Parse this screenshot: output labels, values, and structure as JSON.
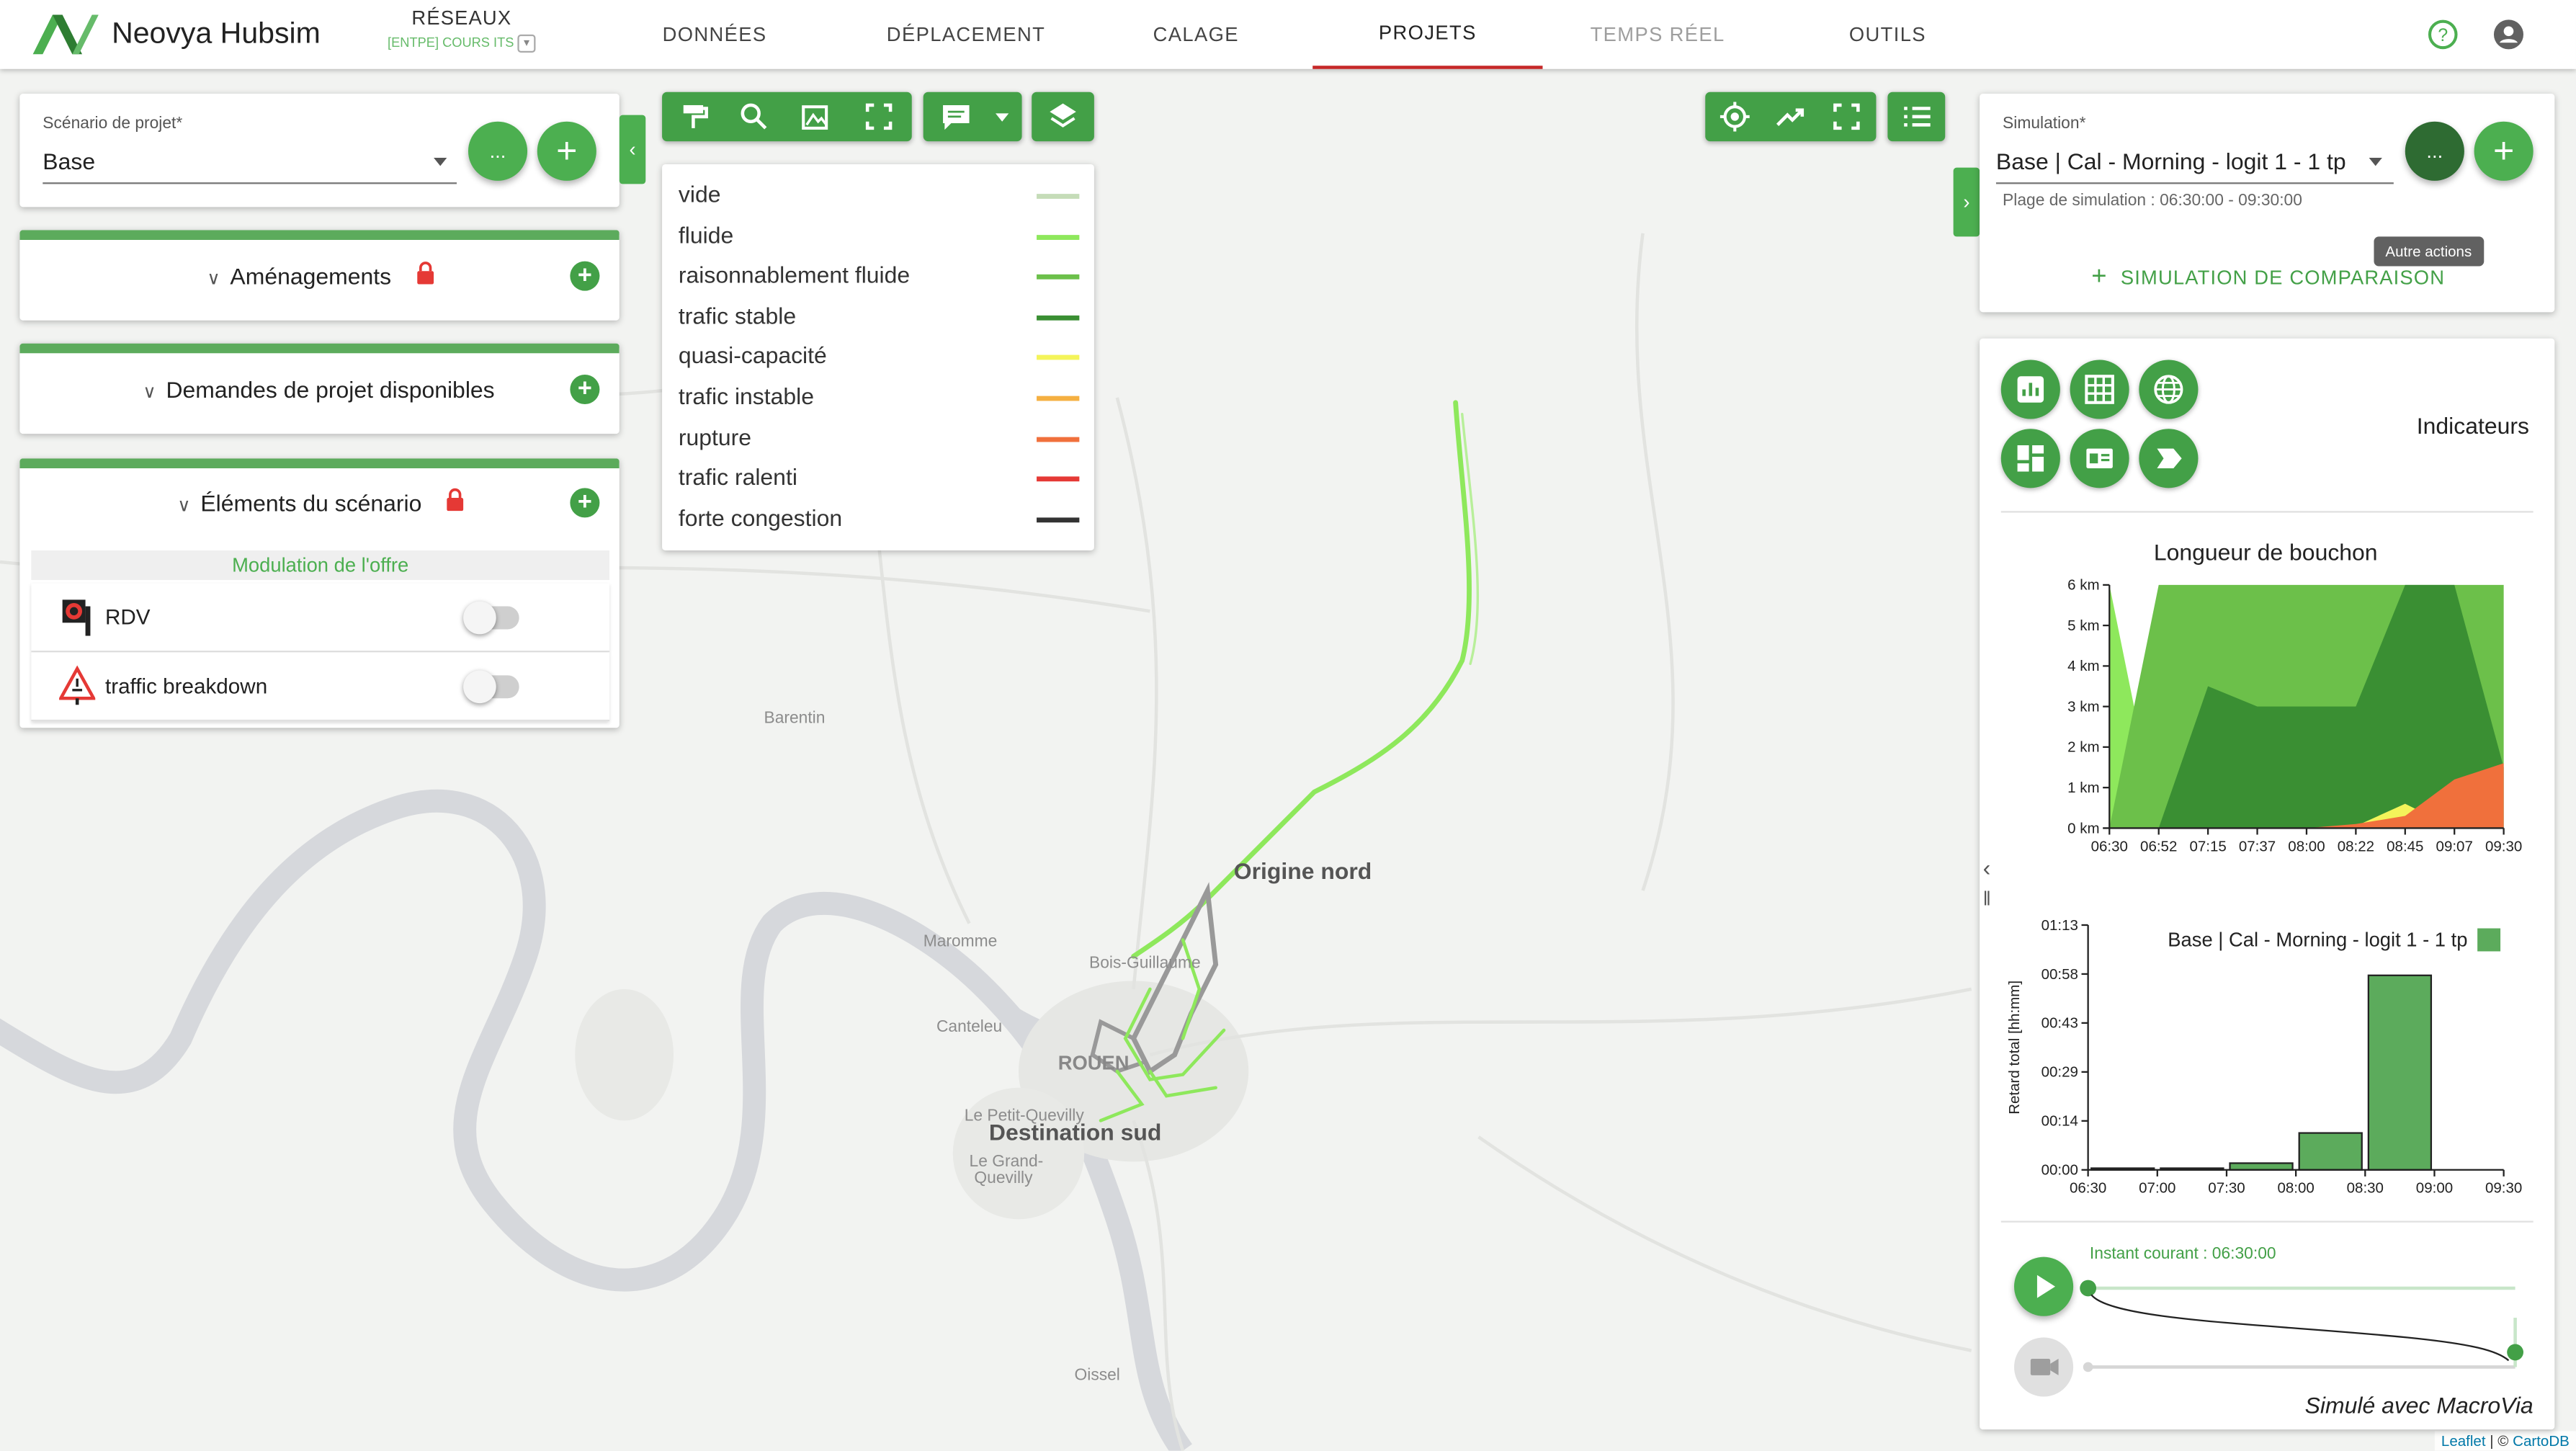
{
  "app": {
    "brand": "Neovya Hubsim"
  },
  "network": {
    "title": "RÉSEAUX",
    "subtitle": "[ENTPE] COURS ITS"
  },
  "nav": [
    "DONNÉES",
    "DÉPLACEMENT",
    "CALAGE",
    "PROJETS",
    "TEMPS RÉEL",
    "OUTILS"
  ],
  "scenario": {
    "label": "Scénario de projet",
    "value": "Base",
    "more": "..."
  },
  "sections": {
    "amenagements": "Aménagements",
    "demandes": "Demandes de projet disponibles",
    "elements": "Éléments du scénario"
  },
  "modulation": {
    "title": "Modulation de l'offre",
    "items": [
      {
        "label": "RDV",
        "enabled": false
      },
      {
        "label": "traffic breakdown",
        "enabled": false
      }
    ]
  },
  "legend": [
    {
      "label": "vide",
      "color": "#c5dcb8"
    },
    {
      "label": "fluide",
      "color": "#8ee85c"
    },
    {
      "label": "raisonnablement fluide",
      "color": "#6cc04a"
    },
    {
      "label": "trafic stable",
      "color": "#3a8f33"
    },
    {
      "label": "quasi-capacité",
      "color": "#f4f45a"
    },
    {
      "label": "trafic instable",
      "color": "#f5b041"
    },
    {
      "label": "rupture",
      "color": "#f0703c"
    },
    {
      "label": "trafic ralenti",
      "color": "#e53935"
    },
    {
      "label": "forte congestion",
      "color": "#333333"
    }
  ],
  "places": {
    "barentin": "Barentin",
    "maromme": "Maromme",
    "bois": "Bois-Guillaume",
    "canteleu": "Canteleu",
    "rouen": "ROUEN",
    "petit": "Le Petit-Quevilly",
    "grand1": "Le Grand-",
    "grand2": "Quevilly",
    "oissel": "Oissel",
    "origin": "Origine nord",
    "dest": "Destination sud"
  },
  "attribution": {
    "leaflet": "Leaflet",
    "sep": " | © ",
    "carto": "CartoDB"
  },
  "simulation": {
    "label": "Simulation",
    "value": "Base | Cal - Morning - logit 1 - 1 tp",
    "range": "Plage de simulation : 06:30:00 - 09:30:00",
    "tooltip": "Autre actions",
    "compare": "SIMULATION DE COMPARAISON",
    "more": "..."
  },
  "indicators": {
    "title": "Indicateurs",
    "icons": [
      "bar-chart-icon",
      "table-icon",
      "globe-icon",
      "dashboard-icon",
      "card-icon",
      "label-icon"
    ]
  },
  "player": {
    "current": "Instant courant : 06:30:00",
    "footer": "Simulé avec MacroVia",
    "progress": 0
  },
  "chart_data": [
    {
      "type": "area",
      "title": "Longueur de bouchon",
      "x": [
        "06:30",
        "06:52",
        "07:15",
        "07:37",
        "08:00",
        "08:22",
        "08:45",
        "09:07",
        "09:30"
      ],
      "y_ticks": [
        "0 km",
        "1 km",
        "2 km",
        "3 km",
        "4 km",
        "5 km",
        "6 km"
      ],
      "ylim": [
        0,
        6
      ],
      "series": [
        {
          "color": "#8ee85c",
          "values": [
            6,
            0,
            0,
            0,
            0,
            0,
            0,
            0,
            0
          ]
        },
        {
          "color": "#6cc04a",
          "values": [
            0,
            6,
            6,
            6,
            6,
            6,
            6,
            6,
            6
          ]
        },
        {
          "color": "#3a8f33",
          "values": [
            0,
            0,
            3.5,
            3,
            3,
            3,
            6,
            6,
            1.5
          ]
        },
        {
          "color": "#f4f45a",
          "values": [
            0,
            0,
            0,
            0,
            0,
            0.05,
            0.6,
            0,
            0
          ]
        },
        {
          "color": "#f0703c",
          "values": [
            0,
            0,
            0,
            0,
            0,
            0.1,
            0.3,
            1.2,
            1.6
          ]
        }
      ]
    },
    {
      "type": "bar",
      "x": [
        "06:30",
        "07:00",
        "07:30",
        "08:00",
        "08:30",
        "09:00",
        "09:30"
      ],
      "y_ticks": [
        "00:00",
        "00:14",
        "00:29",
        "00:43",
        "00:58",
        "01:13"
      ],
      "ylabel": "Retard total [hh:mm]",
      "ylim_minutes": [
        0,
        73
      ],
      "series": [
        {
          "name": "Base | Cal - Morning - logit 1 - 1 tp",
          "color": "#5cab5c",
          "values_minutes": [
            0,
            0,
            0,
            2,
            11,
            58
          ]
        }
      ]
    }
  ]
}
